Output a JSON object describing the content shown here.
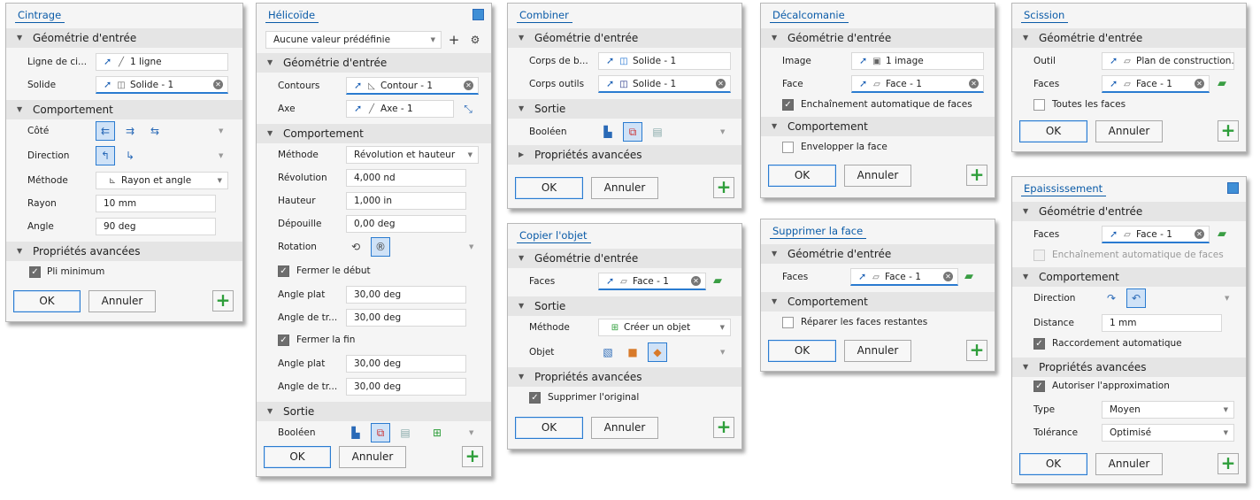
{
  "common": {
    "ok": "OK",
    "cancel": "Annuler",
    "geom": "Géométrie d'entrée",
    "behavior": "Comportement",
    "advanced": "Propriétés avancées",
    "output": "Sortie",
    "arrow_open": "▼",
    "arrow_closed": "▶"
  },
  "cintrage": {
    "title": "Cintrage",
    "ligne_label": "Ligne de ci...",
    "ligne_value": "1 ligne",
    "solide_label": "Solide",
    "solide_value": "Solide - 1",
    "cote_label": "Côté",
    "direction_label": "Direction",
    "methode_label": "Méthode",
    "methode_value": "Rayon et angle",
    "rayon_label": "Rayon",
    "rayon_value": "10 mm",
    "angle_label": "Angle",
    "angle_value": "90 deg",
    "pli_label": "Pli minimum"
  },
  "helicoide": {
    "title": "Hélicoïde",
    "preset": "Aucune valeur prédéfinie",
    "contours_label": "Contours",
    "contours_value": "Contour - 1",
    "axe_label": "Axe",
    "axe_value": "Axe - 1",
    "methode_label": "Méthode",
    "methode_value": "Révolution et hauteur",
    "revolution_label": "Révolution",
    "revolution_value": "4,000 nd",
    "hauteur_label": "Hauteur",
    "hauteur_value": "1,000 in",
    "depouille_label": "Dépouille",
    "depouille_value": "0,00 deg",
    "rotation_label": "Rotation",
    "fermer_debut": "Fermer le début",
    "angle_plat1_label": "Angle plat",
    "angle_plat1_value": "30,00 deg",
    "angle_tr1_label": "Angle de tr...",
    "angle_tr1_value": "30,00 deg",
    "fermer_fin": "Fermer la fin",
    "angle_plat2_label": "Angle plat",
    "angle_plat2_value": "30,00 deg",
    "angle_tr2_label": "Angle de tr...",
    "angle_tr2_value": "30,00 deg",
    "booleen_label": "Booléen"
  },
  "combiner": {
    "title": "Combiner",
    "corps_base_label": "Corps de b...",
    "corps_base_value": "Solide - 1",
    "corps_outils_label": "Corps outils",
    "corps_outils_value": "Solide - 1",
    "booleen_label": "Booléen"
  },
  "copier": {
    "title": "Copier l'objet",
    "faces_label": "Faces",
    "faces_value": "Face - 1",
    "methode_label": "Méthode",
    "methode_value": "Créer un objet",
    "objet_label": "Objet",
    "supprimer_label": "Supprimer l'original"
  },
  "decalco": {
    "title": "Décalcomanie",
    "image_label": "Image",
    "image_value": "1 image",
    "face_label": "Face",
    "face_value": "Face - 1",
    "enchain_label": "Enchaînement automatique de faces",
    "envelopper_label": "Envelopper la face"
  },
  "supprimer": {
    "title": "Supprimer la face",
    "faces_label": "Faces",
    "faces_value": "Face - 1",
    "reparer_label": "Réparer les faces restantes"
  },
  "scission": {
    "title": "Scission",
    "outil_label": "Outil",
    "outil_value": "Plan de construction...",
    "faces_label": "Faces",
    "faces_value": "Face - 1",
    "toutes_label": "Toutes les faces"
  },
  "epais": {
    "title": "Epaississement",
    "faces_label": "Faces",
    "faces_value": "Face - 1",
    "enchain_label": "Enchaînement automatique de faces",
    "direction_label": "Direction",
    "distance_label": "Distance",
    "distance_value": "1 mm",
    "raccord_label": "Raccordement automatique",
    "approx_label": "Autoriser l'approximation",
    "type_label": "Type",
    "type_value": "Moyen",
    "tolerance_label": "Tolérance",
    "tolerance_value": "Optimisé"
  }
}
